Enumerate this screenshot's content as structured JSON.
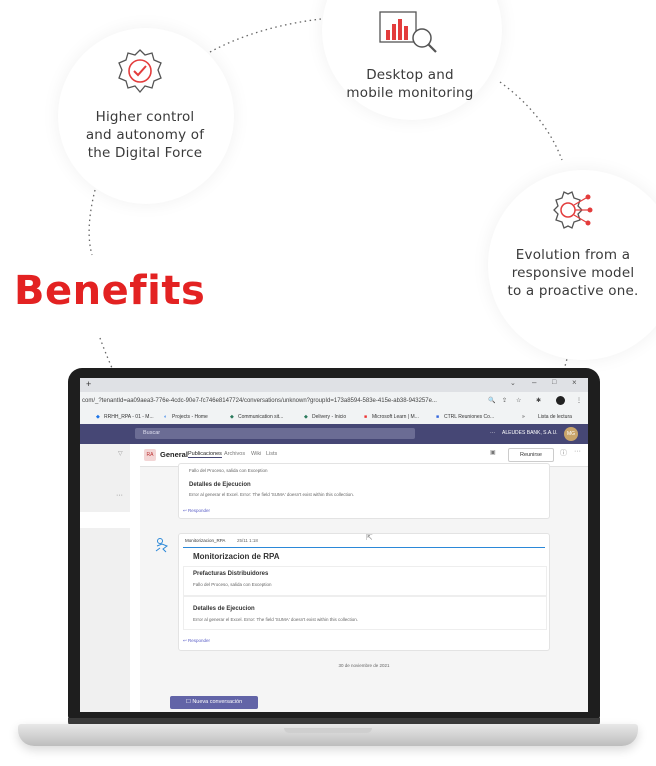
{
  "benefits": {
    "title": "Benefits",
    "items": [
      {
        "text_lines": [
          "Higher control",
          "and autonomy of",
          "the Digital Force"
        ],
        "icon": "gear-check-icon"
      },
      {
        "text_lines": [
          "Desktop and",
          "mobile monitoring"
        ],
        "icon": "chart-magnifier-icon"
      },
      {
        "text_lines": [
          "Evolution from a",
          "responsive model",
          "to a proactive one."
        ],
        "icon": "gear-network-icon"
      }
    ]
  },
  "colors": {
    "accent": "#e32222",
    "teams_purple": "#464775",
    "icon_red": "#e33c3c"
  },
  "browser": {
    "url": "com/_?tenantId=aa09aea3-776e-4cdc-90e7-fc746e8147724/conversations/unknown?groupId=173a8594-583e-415e-ab38-943257e...",
    "bookmarks": [
      "RRHH_RPA - 01 - M...",
      "Projects - Home",
      "Communication sit...",
      "Delivery - Inicio",
      "Microsoft Learn | M...",
      "CTRL Reuniones Co...",
      "Lista de lectura"
    ]
  },
  "teams": {
    "search_placeholder": "Buscar",
    "org_name": "ALEUDES BANK, S.A.U.",
    "avatar_initials": "MG",
    "channel": {
      "avatar": "RA",
      "name": "General",
      "tabs": [
        "Publicaciones",
        "Archivos",
        "Wiki",
        "Lists"
      ],
      "meet_button": "Reunirse"
    },
    "feed": {
      "prev_message": {
        "line": "Fallo del Proceso, salida con Exception",
        "section_title": "Detalles de Ejecucion",
        "section_body": "Error al generar el Excel. Error: The field 'SUMA' doesn't exist within this collection.",
        "reply": "Responder"
      },
      "message": {
        "sender": "Monitorizacion_RPA",
        "time": "25/11 1:18",
        "title": "Monitorizacion de RPA",
        "sections": [
          {
            "title": "Prefacturas Distribuidores",
            "body": "Fallo del Proceso, salida con Exception"
          },
          {
            "title": "Detalles de Ejecucion",
            "body": "Error al generar el Excel. Error: The field 'SUMA' doesn't exist within this collection."
          }
        ],
        "reply": "Responder"
      },
      "date_divider": "30 de noviembre de 2021",
      "new_conversation": "Nueva conversación"
    }
  }
}
